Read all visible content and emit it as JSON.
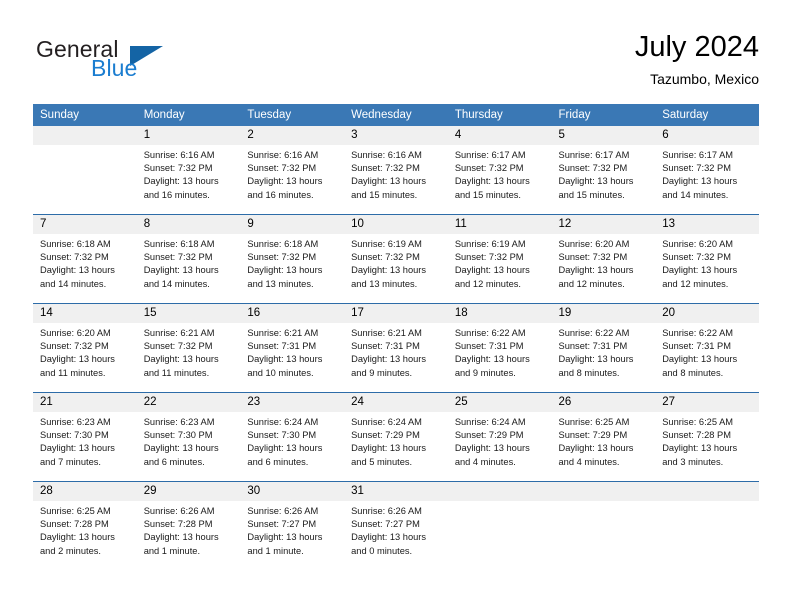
{
  "brand": {
    "line1": "General",
    "line2": "Blue",
    "colors": {
      "general": "#231f20",
      "blue": "#1b7dd0",
      "triangle": "#1464a5"
    }
  },
  "header": {
    "title": "July 2024",
    "subtitle": "Tazumbo, Mexico"
  },
  "theme": {
    "header_bg": "#3a78b5",
    "row_divider": "#2d6ca8",
    "daynum_bg": "#f0f0f0",
    "page_bg": "#ffffff"
  },
  "weekday_headers": [
    "Sunday",
    "Monday",
    "Tuesday",
    "Wednesday",
    "Thursday",
    "Friday",
    "Saturday"
  ],
  "weeks": [
    [
      {
        "day": "",
        "sunrise": "",
        "sunset": "",
        "daylight1": "",
        "daylight2": ""
      },
      {
        "day": "1",
        "sunrise": "Sunrise: 6:16 AM",
        "sunset": "Sunset: 7:32 PM",
        "daylight1": "Daylight: 13 hours",
        "daylight2": "and 16 minutes."
      },
      {
        "day": "2",
        "sunrise": "Sunrise: 6:16 AM",
        "sunset": "Sunset: 7:32 PM",
        "daylight1": "Daylight: 13 hours",
        "daylight2": "and 16 minutes."
      },
      {
        "day": "3",
        "sunrise": "Sunrise: 6:16 AM",
        "sunset": "Sunset: 7:32 PM",
        "daylight1": "Daylight: 13 hours",
        "daylight2": "and 15 minutes."
      },
      {
        "day": "4",
        "sunrise": "Sunrise: 6:17 AM",
        "sunset": "Sunset: 7:32 PM",
        "daylight1": "Daylight: 13 hours",
        "daylight2": "and 15 minutes."
      },
      {
        "day": "5",
        "sunrise": "Sunrise: 6:17 AM",
        "sunset": "Sunset: 7:32 PM",
        "daylight1": "Daylight: 13 hours",
        "daylight2": "and 15 minutes."
      },
      {
        "day": "6",
        "sunrise": "Sunrise: 6:17 AM",
        "sunset": "Sunset: 7:32 PM",
        "daylight1": "Daylight: 13 hours",
        "daylight2": "and 14 minutes."
      }
    ],
    [
      {
        "day": "7",
        "sunrise": "Sunrise: 6:18 AM",
        "sunset": "Sunset: 7:32 PM",
        "daylight1": "Daylight: 13 hours",
        "daylight2": "and 14 minutes."
      },
      {
        "day": "8",
        "sunrise": "Sunrise: 6:18 AM",
        "sunset": "Sunset: 7:32 PM",
        "daylight1": "Daylight: 13 hours",
        "daylight2": "and 14 minutes."
      },
      {
        "day": "9",
        "sunrise": "Sunrise: 6:18 AM",
        "sunset": "Sunset: 7:32 PM",
        "daylight1": "Daylight: 13 hours",
        "daylight2": "and 13 minutes."
      },
      {
        "day": "10",
        "sunrise": "Sunrise: 6:19 AM",
        "sunset": "Sunset: 7:32 PM",
        "daylight1": "Daylight: 13 hours",
        "daylight2": "and 13 minutes."
      },
      {
        "day": "11",
        "sunrise": "Sunrise: 6:19 AM",
        "sunset": "Sunset: 7:32 PM",
        "daylight1": "Daylight: 13 hours",
        "daylight2": "and 12 minutes."
      },
      {
        "day": "12",
        "sunrise": "Sunrise: 6:20 AM",
        "sunset": "Sunset: 7:32 PM",
        "daylight1": "Daylight: 13 hours",
        "daylight2": "and 12 minutes."
      },
      {
        "day": "13",
        "sunrise": "Sunrise: 6:20 AM",
        "sunset": "Sunset: 7:32 PM",
        "daylight1": "Daylight: 13 hours",
        "daylight2": "and 12 minutes."
      }
    ],
    [
      {
        "day": "14",
        "sunrise": "Sunrise: 6:20 AM",
        "sunset": "Sunset: 7:32 PM",
        "daylight1": "Daylight: 13 hours",
        "daylight2": "and 11 minutes."
      },
      {
        "day": "15",
        "sunrise": "Sunrise: 6:21 AM",
        "sunset": "Sunset: 7:32 PM",
        "daylight1": "Daylight: 13 hours",
        "daylight2": "and 11 minutes."
      },
      {
        "day": "16",
        "sunrise": "Sunrise: 6:21 AM",
        "sunset": "Sunset: 7:31 PM",
        "daylight1": "Daylight: 13 hours",
        "daylight2": "and 10 minutes."
      },
      {
        "day": "17",
        "sunrise": "Sunrise: 6:21 AM",
        "sunset": "Sunset: 7:31 PM",
        "daylight1": "Daylight: 13 hours",
        "daylight2": "and 9 minutes."
      },
      {
        "day": "18",
        "sunrise": "Sunrise: 6:22 AM",
        "sunset": "Sunset: 7:31 PM",
        "daylight1": "Daylight: 13 hours",
        "daylight2": "and 9 minutes."
      },
      {
        "day": "19",
        "sunrise": "Sunrise: 6:22 AM",
        "sunset": "Sunset: 7:31 PM",
        "daylight1": "Daylight: 13 hours",
        "daylight2": "and 8 minutes."
      },
      {
        "day": "20",
        "sunrise": "Sunrise: 6:22 AM",
        "sunset": "Sunset: 7:31 PM",
        "daylight1": "Daylight: 13 hours",
        "daylight2": "and 8 minutes."
      }
    ],
    [
      {
        "day": "21",
        "sunrise": "Sunrise: 6:23 AM",
        "sunset": "Sunset: 7:30 PM",
        "daylight1": "Daylight: 13 hours",
        "daylight2": "and 7 minutes."
      },
      {
        "day": "22",
        "sunrise": "Sunrise: 6:23 AM",
        "sunset": "Sunset: 7:30 PM",
        "daylight1": "Daylight: 13 hours",
        "daylight2": "and 6 minutes."
      },
      {
        "day": "23",
        "sunrise": "Sunrise: 6:24 AM",
        "sunset": "Sunset: 7:30 PM",
        "daylight1": "Daylight: 13 hours",
        "daylight2": "and 6 minutes."
      },
      {
        "day": "24",
        "sunrise": "Sunrise: 6:24 AM",
        "sunset": "Sunset: 7:29 PM",
        "daylight1": "Daylight: 13 hours",
        "daylight2": "and 5 minutes."
      },
      {
        "day": "25",
        "sunrise": "Sunrise: 6:24 AM",
        "sunset": "Sunset: 7:29 PM",
        "daylight1": "Daylight: 13 hours",
        "daylight2": "and 4 minutes."
      },
      {
        "day": "26",
        "sunrise": "Sunrise: 6:25 AM",
        "sunset": "Sunset: 7:29 PM",
        "daylight1": "Daylight: 13 hours",
        "daylight2": "and 4 minutes."
      },
      {
        "day": "27",
        "sunrise": "Sunrise: 6:25 AM",
        "sunset": "Sunset: 7:28 PM",
        "daylight1": "Daylight: 13 hours",
        "daylight2": "and 3 minutes."
      }
    ],
    [
      {
        "day": "28",
        "sunrise": "Sunrise: 6:25 AM",
        "sunset": "Sunset: 7:28 PM",
        "daylight1": "Daylight: 13 hours",
        "daylight2": "and 2 minutes."
      },
      {
        "day": "29",
        "sunrise": "Sunrise: 6:26 AM",
        "sunset": "Sunset: 7:28 PM",
        "daylight1": "Daylight: 13 hours",
        "daylight2": "and 1 minute."
      },
      {
        "day": "30",
        "sunrise": "Sunrise: 6:26 AM",
        "sunset": "Sunset: 7:27 PM",
        "daylight1": "Daylight: 13 hours",
        "daylight2": "and 1 minute."
      },
      {
        "day": "31",
        "sunrise": "Sunrise: 6:26 AM",
        "sunset": "Sunset: 7:27 PM",
        "daylight1": "Daylight: 13 hours",
        "daylight2": "and 0 minutes."
      },
      {
        "day": "",
        "sunrise": "",
        "sunset": "",
        "daylight1": "",
        "daylight2": ""
      },
      {
        "day": "",
        "sunrise": "",
        "sunset": "",
        "daylight1": "",
        "daylight2": ""
      },
      {
        "day": "",
        "sunrise": "",
        "sunset": "",
        "daylight1": "",
        "daylight2": ""
      }
    ]
  ]
}
